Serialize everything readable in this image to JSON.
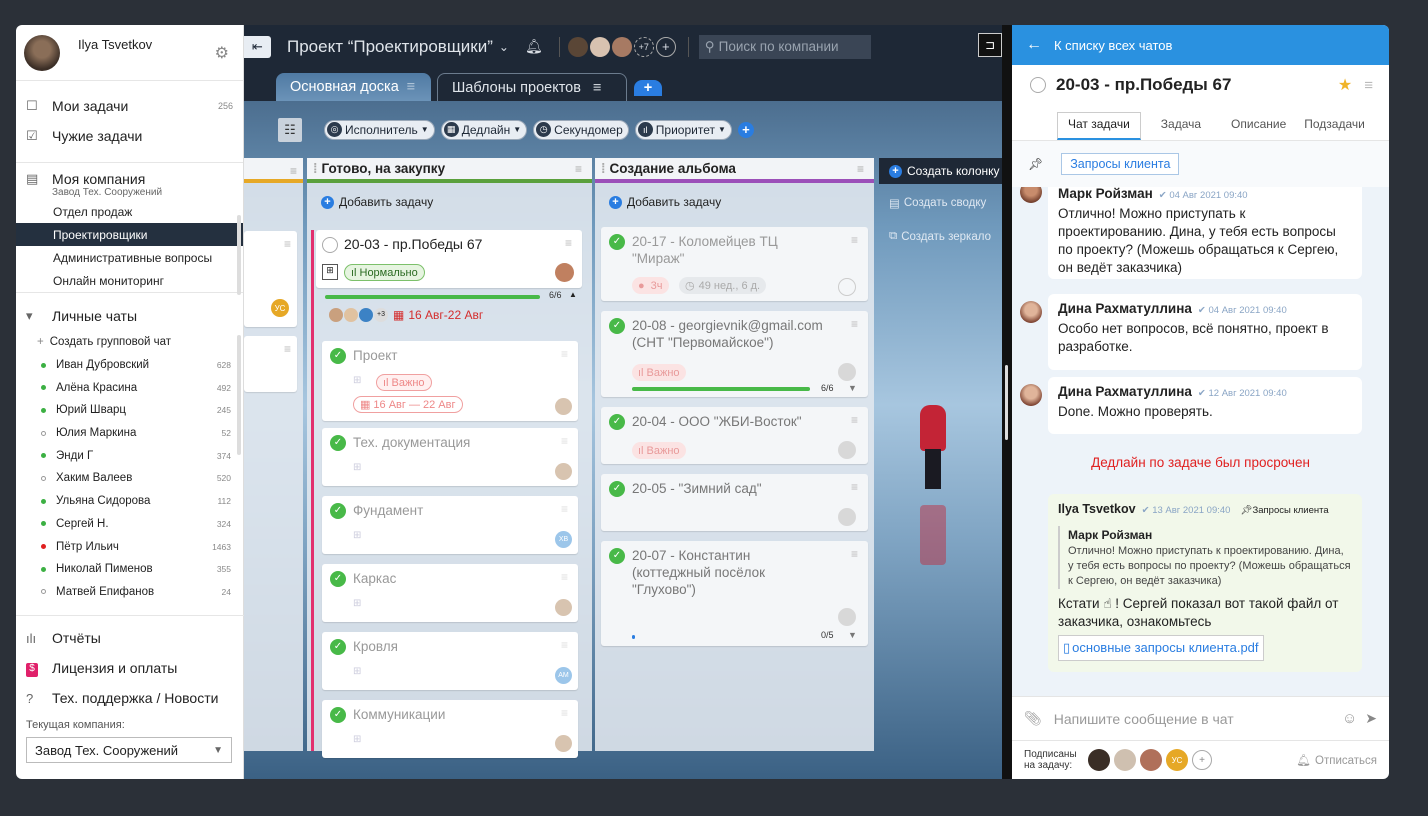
{
  "sidebar": {
    "user_name": "Ilya Tsvetkov",
    "nav": [
      {
        "label": "Мои задачи",
        "count": "256"
      },
      {
        "label": "Чужие задачи",
        "count": ""
      }
    ],
    "company": {
      "label": "Моя компания",
      "sub": "Завод Тех. Сооружений"
    },
    "departments": [
      "Отдел продаж",
      "Проектировщики",
      "Административные вопросы",
      "Онлайн мониторинг"
    ],
    "chats_title": "Личные чаты",
    "create_group": "Создать групповой чат",
    "chats": [
      {
        "name": "Иван Дубровский",
        "count": "628",
        "color": "#3cb043"
      },
      {
        "name": "Алёна Красина",
        "count": "492",
        "color": "#3cb043"
      },
      {
        "name": "Юрий Шварц",
        "count": "245",
        "color": "#3cb043"
      },
      {
        "name": "Юлия Маркина",
        "count": "52",
        "color": "#ffffff"
      },
      {
        "name": "Энди Г",
        "count": "374",
        "color": "#3cb043"
      },
      {
        "name": "Хаким Валеев",
        "count": "520",
        "color": "#ffffff"
      },
      {
        "name": "Ульяна Сидорова",
        "count": "112",
        "color": "#3cb043"
      },
      {
        "name": "Сергей Н.",
        "count": "324",
        "color": "#3cb043"
      },
      {
        "name": "Пётр Ильич",
        "count": "1463",
        "color": "#e02020"
      },
      {
        "name": "Николай Пименов",
        "count": "355",
        "color": "#3cb043"
      },
      {
        "name": "Матвей Епифанов",
        "count": "24",
        "color": "#ffffff"
      }
    ],
    "reports": "Отчёты",
    "license": "Лицензия и оплаты",
    "support": "Тех. поддержка / Новости",
    "current_company_label": "Текущая компания:",
    "current_company": "Завод Тех. Сооружений"
  },
  "board": {
    "project_title": "Проект “Проектировщики”",
    "extra_members": "+7",
    "search_placeholder": "Поиск по компании",
    "tabs": [
      "Основная доска",
      "Шаблоны проектов"
    ],
    "filters": [
      "Исполнитель",
      "Дедлайн",
      "Секундомер",
      "Приоритет"
    ],
    "create_column": "Создать колонку",
    "create_summary": "Создать сводку",
    "create_mirror": "Создать зеркало",
    "left_col_badge": "УС",
    "col1": {
      "title": "Готово, на закупку",
      "add": "Добавить задачу",
      "main_card": {
        "title": "20-03 - пр.Победы 67",
        "priority": "Нормально",
        "progress": "6/6",
        "progress_value": 1,
        "deadline": "16 Авг-22 Авг",
        "more": "+3"
      },
      "subtasks": [
        {
          "title": "Проект",
          "priority": "Важно",
          "date": "16 Авг — 22 Авг"
        },
        {
          "title": "Тех. документация"
        },
        {
          "title": "Фундамент",
          "badge": "ХВ"
        },
        {
          "title": "Каркас"
        },
        {
          "title": "Кровля",
          "badge": "АМ"
        },
        {
          "title": "Коммуникации"
        }
      ]
    },
    "col2": {
      "title": "Создание альбома",
      "add": "Добавить задачу",
      "cards": [
        {
          "title": "20-17 - Коломейцев ТЦ \"Мираж\"",
          "time": "3ч",
          "duration": "49 нед., 6 д."
        },
        {
          "title": "20-08 - georgievnik@gmail.com (СНТ \"Первомайское\")",
          "priority": "Важно",
          "progress": "6/6",
          "progress_value": 1
        },
        {
          "title": "20-04 - ООО \"ЖБИ-Восток\"",
          "priority": "Важно"
        },
        {
          "title": "20-05 - \"Зимний сад\""
        },
        {
          "title": "20-07 - Константин (коттеджный посёлок \"Глухово\")",
          "progress": "0/5",
          "progress_value": 0
        }
      ]
    }
  },
  "chat": {
    "back": "К списку всех чатов",
    "task_title": "20-03 - пр.Победы 67",
    "tabs": [
      "Чат задачи",
      "Задача",
      "Описание",
      "Подзадачи"
    ],
    "pinned": "Запросы клиента",
    "messages": [
      {
        "name": "Марк Ройзман",
        "time": "04 Авг 2021 09:40",
        "text": "Отлично! Можно приступать к проектированию. Дина, у тебя есть вопросы по проекту? (Можешь обращаться к Сергею, он ведёт заказчика)"
      },
      {
        "name": "Дина Рахматуллина",
        "time": "04 Авг 2021 09:40",
        "text": "Особо нет вопросов, всё понятно, проект в разработке."
      },
      {
        "name": "Дина Рахматуллина",
        "time": "12 Авг 2021 09:40",
        "text": "Done. Можно проверять."
      }
    ],
    "overdue_notice": "Дедлайн по задаче был просрочен",
    "own": {
      "name": "Ilya Tsvetkov",
      "time": "13 Авг 2021 09:40",
      "pin": "Запросы клиента",
      "quote_name": "Марк Ройзман",
      "quote_text": "Отлично! Можно приступать к проектированию. Дина, у тебя есть вопросы по проекту? (Можешь обращаться к Сергею, он ведёт заказчика)",
      "text": "Кстати ☝ ! Сергей показал вот такой файл от заказчика, ознакомьтесь",
      "file": "основные запросы клиента.pdf"
    },
    "placeholder": "Напишите сообщение в чат",
    "subscribers_label": "Подписаны на задачу:",
    "sub_badge": "УС",
    "unsubscribe": "Отписаться"
  },
  "colors": {
    "accent": "#2a91e0",
    "sidebar_dark": "#24303f",
    "success": "#48b948",
    "danger": "#e02020"
  }
}
